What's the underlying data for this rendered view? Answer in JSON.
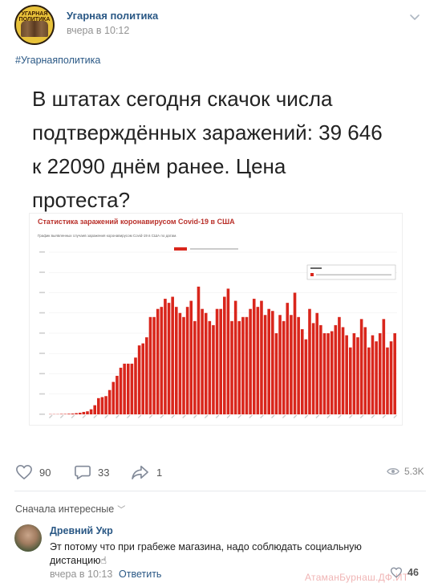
{
  "post": {
    "group_name": "Угарная политика",
    "time": "вчера в 10:12",
    "avatar_text_top": "УГАРНАЯ ПОЛИТИКА",
    "hashtag": "#Угарнаяполитика",
    "text": "В штатах сегодня скачок числа подтверждённых заражений: 39 646 к 22090 днём ранее. Цена протеста?"
  },
  "chart_image": {
    "title": "Статистика заражений коронавирусом Covid-19 в США",
    "subtitle": "График выявленных случаев заражения коронавирусом Covid-19 в США по датам.",
    "bar_color": "#d9261c"
  },
  "chart_data": {
    "type": "bar",
    "title": "Статистика заражений коронавирусом Covid-19 в США",
    "series": [
      {
        "values": [
          0.1,
          0.1,
          0.1,
          0.2,
          0.2,
          0.3,
          0.4,
          0.6,
          0.8,
          1.2,
          1.5,
          2.5,
          4.5,
          8,
          8.5,
          9,
          12,
          16,
          19,
          23,
          25,
          25,
          25,
          28,
          34,
          35,
          38,
          48,
          48,
          52,
          53,
          57,
          55,
          58,
          53,
          50,
          48,
          53,
          56,
          46,
          63,
          52,
          50,
          46,
          44,
          52,
          52,
          58,
          62,
          46,
          56,
          46,
          48,
          48,
          52,
          57,
          53,
          56,
          49,
          52,
          51,
          40,
          49,
          46,
          55,
          49,
          60,
          48,
          42,
          37,
          52,
          45,
          50,
          44,
          40,
          40,
          41,
          44,
          48,
          43,
          39,
          33,
          40,
          38,
          47,
          43,
          33,
          39,
          36,
          40,
          47,
          33,
          36,
          40
        ]
      }
    ],
    "ylim": [
      0,
      80
    ],
    "grid": true,
    "legend_position": "top-right"
  },
  "actions": {
    "likes": "90",
    "comments": "33",
    "shares": "1",
    "views": "5.3K"
  },
  "comments_section": {
    "sort_label": "Сначала интересные",
    "comment": {
      "author": "Древний Укр",
      "text": "Эт потому что при грабеже магазина, надо соблюдать социальную дистанцию☝",
      "time": "вчера в 10:13",
      "reply": "Ответить",
      "likes": "46"
    }
  },
  "watermark": "АтаманБурнаш.ДФ.ИТ",
  "colors": {
    "link": "#2a5885",
    "muted": "#939393",
    "bar": "#d9261c"
  }
}
